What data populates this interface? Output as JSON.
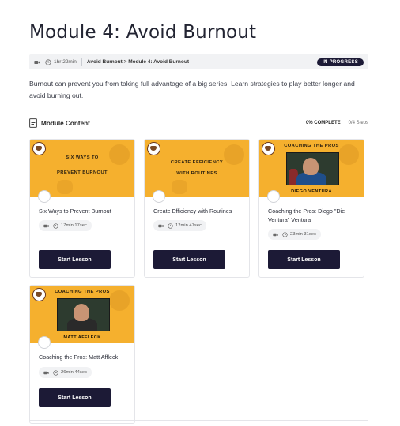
{
  "module": {
    "title": "Module 4: Avoid Burnout",
    "duration": "1hr 22min",
    "breadcrumb": "Avoid Burnout > Module 4: Avoid Burnout",
    "status": "IN PROGRESS",
    "description": "Burnout can prevent you from taking full advantage of a big series. Learn strategies to play better longer and avoid burning out."
  },
  "content": {
    "heading": "Module Content",
    "complete": "0% COMPLETE",
    "steps": "0/4 Steps"
  },
  "lessons": [
    {
      "thumb_line1": "SIX WAYS TO",
      "thumb_line2": "PREVENT BURNOUT",
      "title": "Six Ways to Prevent Burnout",
      "time": "17min 17sec",
      "button": "Start Lesson"
    },
    {
      "thumb_line1": "CREATE EFFICIENCY",
      "thumb_line2": "WITH ROUTINES",
      "title": "Create Efficiency with Routines",
      "time": "12min 47sec",
      "button": "Start Lesson"
    },
    {
      "thumb_line1": "COACHING THE PROS",
      "thumb_name": "DIEGO VENTURA",
      "title": "Coaching the Pros: Diego \"Die Ventura\" Ventura",
      "time": "23min 31sec",
      "button": "Start Lesson"
    },
    {
      "thumb_line1": "COACHING THE PROS",
      "thumb_name": "MATT AFFLECK",
      "title": "Coaching the Pros: Matt Affleck",
      "time": "26min 44sec",
      "button": "Start Lesson"
    }
  ],
  "icons": {
    "video": "video-camera-icon",
    "clock": "clock-icon",
    "document": "document-icon"
  }
}
